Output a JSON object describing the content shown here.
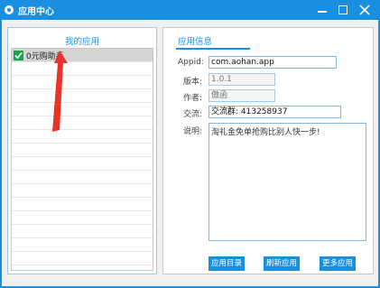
{
  "window": {
    "title": "应用中心"
  },
  "left_panel": {
    "title": "我的应用",
    "items": [
      {
        "label": "0元购助手",
        "checked": true,
        "selected": true
      }
    ]
  },
  "right_panel": {
    "title": "应用信息",
    "fields": {
      "appid": {
        "label": "Appid:",
        "value": "com.aohan.app"
      },
      "version": {
        "label": "版本:",
        "value": "1.0.1"
      },
      "author": {
        "label": "作者:",
        "value": "傲函"
      },
      "contact": {
        "label": "交流:",
        "value": "交流群: 413258937"
      },
      "description": {
        "label": "说明:",
        "value": "淘礼金免单抢购比别人快一步!"
      }
    },
    "buttons": {
      "app_directory": "应用目录",
      "refresh_app": "刷新应用",
      "more_apps": "更多应用"
    }
  },
  "colors": {
    "accent": "#1a8fe0",
    "checkbox": "#1aa34a",
    "annotation_arrow": "#e8332b"
  },
  "icons": [
    "app-icon",
    "minimize-icon",
    "maximize-icon",
    "close-icon",
    "checkmark-icon",
    "annotation-arrow-icon"
  ]
}
